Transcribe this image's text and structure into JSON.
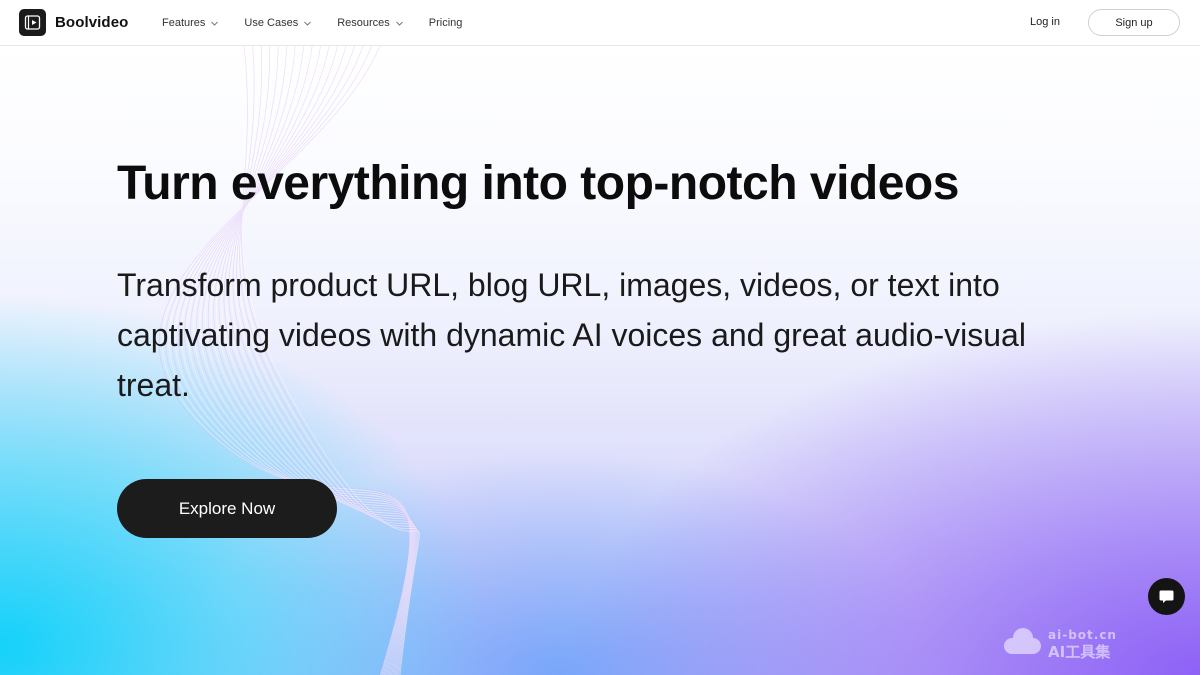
{
  "header": {
    "brand": "Boolvideo",
    "nav": [
      {
        "label": "Features",
        "has_dropdown": true
      },
      {
        "label": "Use Cases",
        "has_dropdown": true
      },
      {
        "label": "Resources",
        "has_dropdown": true
      },
      {
        "label": "Pricing",
        "has_dropdown": false
      }
    ],
    "login_label": "Log in",
    "signup_label": "Sign up"
  },
  "hero": {
    "title": "Turn everything into top-notch videos",
    "subtitle": "Transform product URL, blog URL, images, videos, or text into captivating videos with dynamic AI voices and great audio-visual treat.",
    "cta_label": "Explore Now"
  },
  "watermark": {
    "line1": "ai-bot.cn",
    "line2": "AI工具集"
  },
  "icons": {
    "logo": "play-frame-icon",
    "dropdown": "chevron-down-icon",
    "chat": "chat-bubble-icon"
  },
  "colors": {
    "text_dark": "#0c0c0c",
    "button_dark": "#1c1c1c",
    "gradient_cyan": "#14d2fa",
    "gradient_violet": "#8a5cf6"
  }
}
